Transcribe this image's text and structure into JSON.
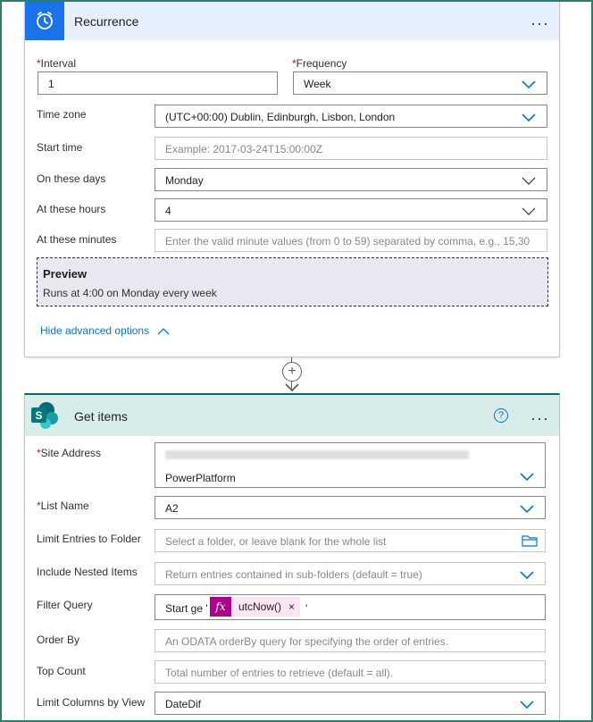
{
  "recurrence": {
    "title": "Recurrence",
    "more": "···",
    "interval_label": "Interval",
    "interval_value": "1",
    "frequency_label": "Frequency",
    "frequency_value": "Week",
    "timezone_label": "Time zone",
    "timezone_value": "(UTC+00:00) Dublin, Edinburgh, Lisbon, London",
    "starttime_label": "Start time",
    "starttime_placeholder": "Example: 2017-03-24T15:00:00Z",
    "days_label": "On these days",
    "days_value": "Monday",
    "hours_label": "At these hours",
    "hours_value": "4",
    "minutes_label": "At these minutes",
    "minutes_placeholder": "Enter the valid minute values (from 0 to 59) separated by comma, e.g., 15,30",
    "preview_title": "Preview",
    "preview_text": "Runs at 4:00 on Monday every week",
    "hide_advanced": "Hide advanced options",
    "accent_color": "#1a73e8"
  },
  "connector": {
    "plus": "+"
  },
  "get_items": {
    "title": "Get items",
    "help": "?",
    "more": "···",
    "site_label": "Site Address",
    "site_value": "PowerPlatform",
    "list_label": "List Name",
    "list_value": "A2",
    "limit_folder_label": "Limit Entries to Folder",
    "limit_folder_placeholder": "Select a folder, or leave blank for the whole list",
    "nested_label": "Include Nested Items",
    "nested_placeholder": "Return entries contained in sub-folders (default = true)",
    "filter_label": "Filter Query",
    "filter_prefix": "Start ge '",
    "filter_token_icon": "fx",
    "filter_token_name": "utcNow()",
    "filter_token_close": "×",
    "filter_suffix": "'",
    "orderby_label": "Order By",
    "orderby_placeholder": "An ODATA orderBy query for specifying the order of entries.",
    "topcount_label": "Top Count",
    "topcount_placeholder": "Total number of entries to retrieve (default = all).",
    "limitview_label": "Limit Columns by View",
    "limitview_value": "DateDif",
    "header_color": "#d8ece9",
    "sharepoint_color": "#036c70"
  }
}
